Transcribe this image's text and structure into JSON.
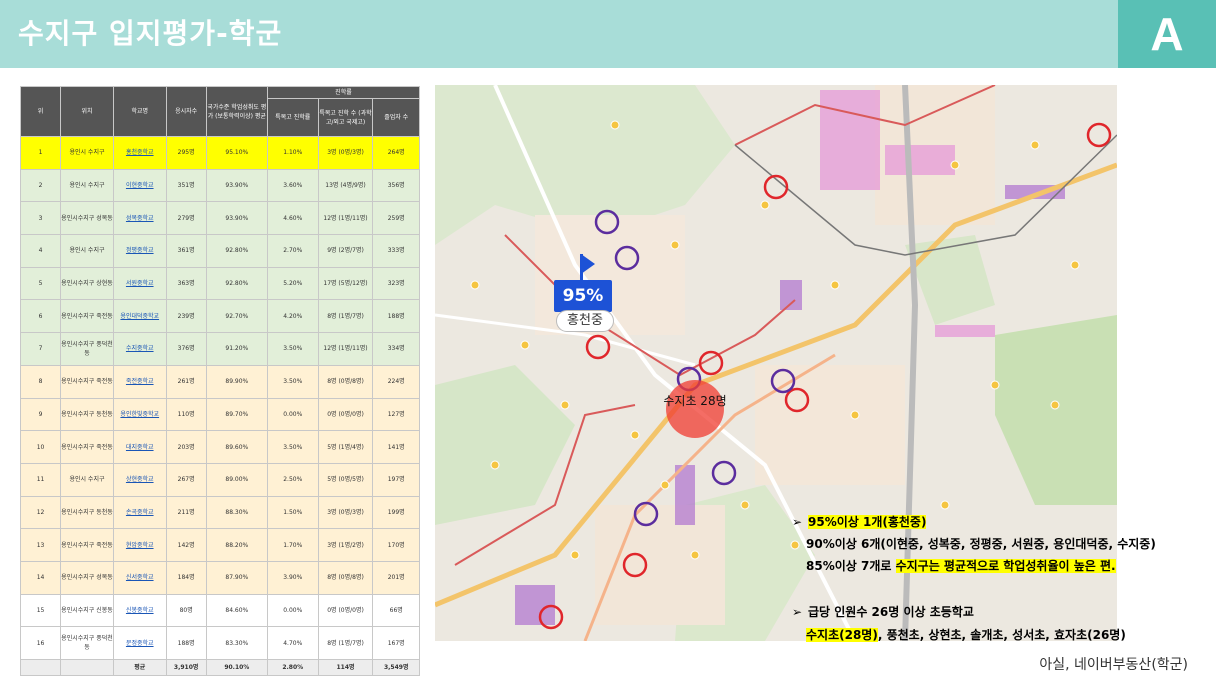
{
  "header": {
    "title": "수지구 입지평가-학군",
    "badge": "A"
  },
  "table": {
    "headers_top": {
      "rank": "위",
      "location": "위치",
      "school": "학교명",
      "exam_count": "응시자수",
      "national_score": "국가수준 학업성취도 평가 (보통학력이상) 평균",
      "progress_group": "진학률"
    },
    "headers_sub": {
      "special": "특목고 진학률",
      "special_detail": "특목고 진학 수 (과학고/외고 국제고)",
      "grads": "졸업자 수"
    },
    "rows": [
      {
        "rank": "1",
        "location": "용인시 수지구",
        "school": "홍천중학교",
        "count": "295명",
        "score": "95.10%",
        "rate": "1.10%",
        "special": "3명 (0명/3명)",
        "grads": "264명",
        "style": "r-y"
      },
      {
        "rank": "2",
        "location": "용인시 수지구",
        "school": "이현중학교",
        "count": "351명",
        "score": "93.90%",
        "rate": "3.60%",
        "special": "13명 (4명/9명)",
        "grads": "356명",
        "style": "r-g"
      },
      {
        "rank": "3",
        "location": "용인시수지구 성복동",
        "school": "성복중학교",
        "count": "279명",
        "score": "93.90%",
        "rate": "4.60%",
        "special": "12명 (1명/11명)",
        "grads": "259명",
        "style": "r-g"
      },
      {
        "rank": "4",
        "location": "용인시 수지구",
        "school": "정평중학교",
        "count": "361명",
        "score": "92.80%",
        "rate": "2.70%",
        "special": "9명 (2명/7명)",
        "grads": "333명",
        "style": "r-g"
      },
      {
        "rank": "5",
        "location": "용인시수지구 상현동",
        "school": "서원중학교",
        "count": "363명",
        "score": "92.80%",
        "rate": "5.20%",
        "special": "17명 (5명/12명)",
        "grads": "323명",
        "style": "r-g"
      },
      {
        "rank": "6",
        "location": "용인시수지구 죽전동",
        "school": "용인대덕중학교",
        "count": "239명",
        "score": "92.70%",
        "rate": "4.20%",
        "special": "8명 (1명/7명)",
        "grads": "188명",
        "style": "r-g"
      },
      {
        "rank": "7",
        "location": "용인시수지구 풍덕천동",
        "school": "수지중학교",
        "count": "376명",
        "score": "91.20%",
        "rate": "3.50%",
        "special": "12명 (1명/11명)",
        "grads": "334명",
        "style": "r-g"
      },
      {
        "rank": "8",
        "location": "용인시수지구 죽전동",
        "school": "죽전중학교",
        "count": "261명",
        "score": "89.90%",
        "rate": "3.50%",
        "special": "8명 (0명/8명)",
        "grads": "224명",
        "style": "r-o"
      },
      {
        "rank": "9",
        "location": "용인시수지구 동천동",
        "school": "용인한빛중학교",
        "count": "110명",
        "score": "89.70%",
        "rate": "0.00%",
        "special": "0명 (0명/0명)",
        "grads": "127명",
        "style": "r-o"
      },
      {
        "rank": "10",
        "location": "용인시수지구 죽전동",
        "school": "대지중학교",
        "count": "203명",
        "score": "89.60%",
        "rate": "3.50%",
        "special": "5명 (1명/4명)",
        "grads": "141명",
        "style": "r-o"
      },
      {
        "rank": "11",
        "location": "용인시 수지구",
        "school": "상현중학교",
        "count": "267명",
        "score": "89.00%",
        "rate": "2.50%",
        "special": "5명 (0명/5명)",
        "grads": "197명",
        "style": "r-o"
      },
      {
        "rank": "12",
        "location": "용인시수지구 동천동",
        "school": "손곡중학교",
        "count": "211명",
        "score": "88.30%",
        "rate": "1.50%",
        "special": "3명 (0명/3명)",
        "grads": "199명",
        "style": "r-o"
      },
      {
        "rank": "13",
        "location": "용인시수지구 죽전동",
        "school": "현암중학교",
        "count": "142명",
        "score": "88.20%",
        "rate": "1.70%",
        "special": "3명 (1명/2명)",
        "grads": "170명",
        "style": "r-o"
      },
      {
        "rank": "14",
        "location": "용인시수지구 성복동",
        "school": "신서중학교",
        "count": "184명",
        "score": "87.90%",
        "rate": "3.90%",
        "special": "8명 (0명/8명)",
        "grads": "201명",
        "style": "r-o"
      },
      {
        "rank": "15",
        "location": "용인시수지구 신봉동",
        "school": "신봉중학교",
        "count": "80명",
        "score": "84.60%",
        "rate": "0.00%",
        "special": "0명 (0명/0명)",
        "grads": "66명",
        "style": "r-w"
      },
      {
        "rank": "16",
        "location": "용인시수지구 풍덕천동",
        "school": "문정중학교",
        "count": "188명",
        "score": "83.30%",
        "rate": "4.70%",
        "special": "8명 (1명/7명)",
        "grads": "167명",
        "style": "r-w"
      }
    ],
    "total": {
      "label": "평균",
      "count": "3,910명",
      "score": "90.10%",
      "rate": "2.80%",
      "special": "114명",
      "grads": "3,549명"
    }
  },
  "map": {
    "highlight_pct": "95%",
    "highlight_name": "홍천중",
    "suji_label": "수지초 28명"
  },
  "notes": {
    "line1": "95%이상 1개(홍천중)",
    "line2": "90%이상 6개(이현중, 성복중, 정평중, 서원중, 용인대덕중, 수지중)",
    "line3_a": "85%이상 7개로 ",
    "line3_b": "수지구는 평균적으로 학업성취율이 높은 편.",
    "line4": "급당 인원수 26명 이상 초등학교",
    "line5_a": "수지초(28명)",
    "line5_b": ", 풍천초, 상현초, 솔개초, 성서초, 효자초(26명)"
  },
  "source": "아실, 네이버부동산(학군)",
  "colors": {
    "header_bg": "#a8ddd8",
    "badge_bg": "#59c0b5",
    "highlight": "#ffff00",
    "pct_blue": "#1d52d6"
  }
}
